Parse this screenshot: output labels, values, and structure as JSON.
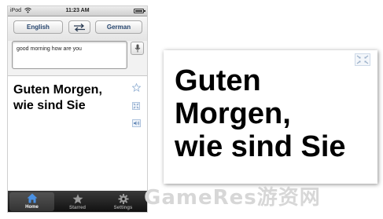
{
  "status_bar": {
    "carrier": "iPod",
    "time": "11:23 AM"
  },
  "lang_bar": {
    "source_language": "English",
    "target_language": "German"
  },
  "input": {
    "value": "good morning how are you"
  },
  "result": {
    "translation_line1": "Guten Morgen,",
    "translation_line2": "wie sind Sie"
  },
  "tab_bar": {
    "home_label": "Home",
    "starred_label": "Starred",
    "settings_label": "Settings",
    "selected": "Home"
  },
  "fullscreen": {
    "line1": "Guten",
    "line2": "Morgen,",
    "line3": "wie sind Sie"
  },
  "watermark": {
    "text": "GameRes游资网"
  },
  "colors": {
    "language_button_text": "#26456e",
    "tab_bar": "#1c1c1c",
    "home_tab_icon": "#4a90e2"
  },
  "icons": [
    "wifi-icon",
    "battery-icon",
    "swap-icon",
    "microphone-icon",
    "star-icon",
    "expand-icon",
    "speaker-icon",
    "home-icon",
    "starred-icon",
    "settings-icon",
    "collapse-icon"
  ]
}
